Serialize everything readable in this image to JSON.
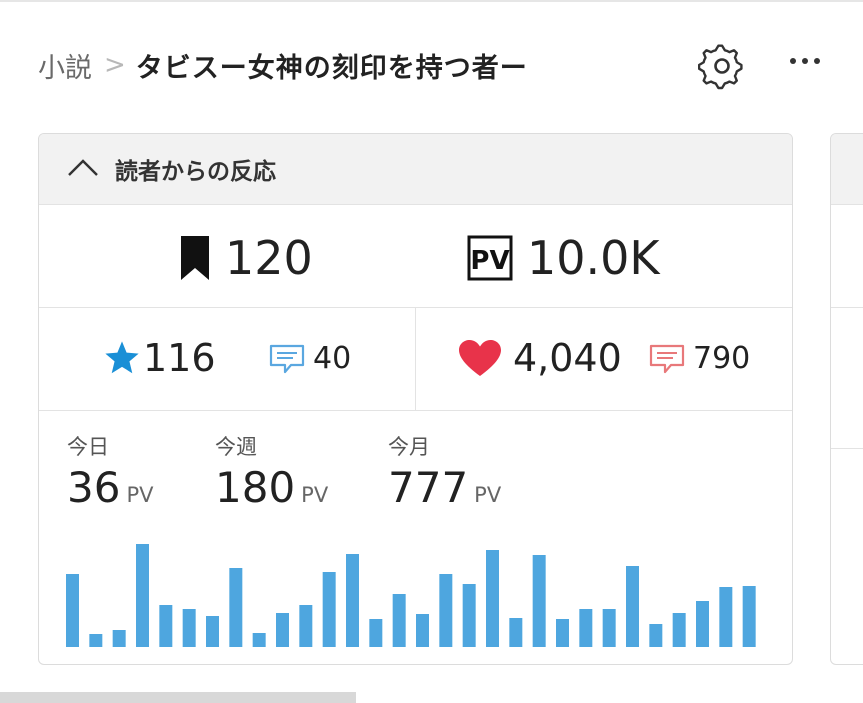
{
  "breadcrumb": {
    "root": "小説",
    "separator": ">",
    "title": "タビスー女神の刻印を持つ者ー"
  },
  "header_icons": [
    "gear-icon",
    "more-icon"
  ],
  "reactions_card": {
    "title": "読者からの反応",
    "bookmarks": "120",
    "pv_total": "10.0K",
    "stars": "116",
    "star_comments": "40",
    "hearts": "4,040",
    "heart_comments": "790",
    "pv_periods": [
      {
        "label": "今日",
        "value": "36",
        "unit": "PV"
      },
      {
        "label": "今週",
        "value": "180",
        "unit": "PV"
      },
      {
        "label": "今月",
        "value": "777",
        "unit": "PV"
      }
    ]
  },
  "colors": {
    "bar": "#4ea6df",
    "star": "#1a8fd6",
    "heart": "#e8334a",
    "star_comment": "#5aa7e0",
    "heart_comment": "#e8787a"
  },
  "chart_data": {
    "type": "bar",
    "values": [
      73,
      13,
      17,
      103,
      42,
      38,
      31,
      79,
      14,
      34,
      42,
      75,
      93,
      28,
      53,
      33,
      73,
      63,
      97,
      29,
      92,
      28,
      38,
      38,
      81,
      23,
      34,
      46,
      60,
      61
    ],
    "ylim": [
      0,
      103
    ]
  }
}
